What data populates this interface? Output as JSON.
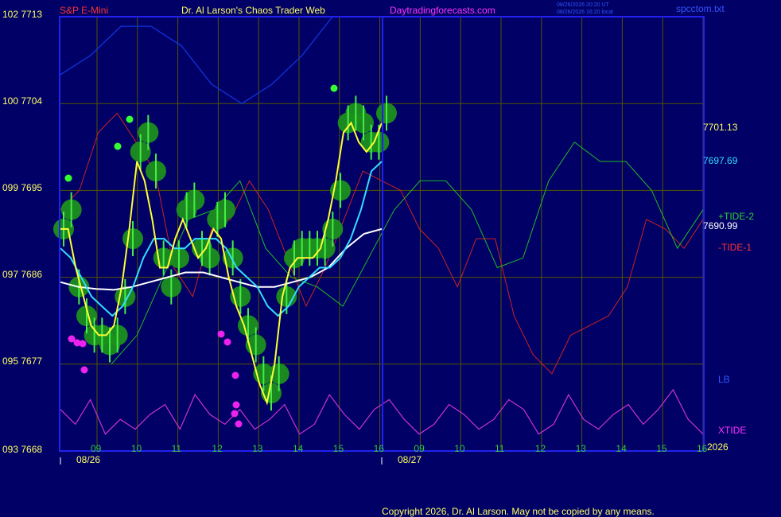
{
  "header": {
    "symbol": "S&P E-Mini",
    "title": "Dr. Al Larson's Chaos Trader Web",
    "site": "Daytradingforecasts.com",
    "time_utc": "08/26/2026 20:20 UT",
    "time_local": "08/26/2026 16:20 local",
    "file": "spcctom.txt"
  },
  "colors": {
    "background": "#000066",
    "frame": "#2222ee",
    "grid": "#555500",
    "price_bars": "#22cc22",
    "fast_ma": "#ffff33",
    "mid_ma": "#33ddff",
    "slow_ma": "#ffffff",
    "tide_minus": "#cc2222",
    "tide_plus": "#22bb22",
    "lb_line": "#1133dd",
    "xtide": "#cc33cc",
    "markers_magenta": "#ee22ee",
    "text_red": "#ff3333",
    "text_yellow": "#ffff66",
    "text_magenta": "#ff33ff",
    "text_green": "#33cc33"
  },
  "right_labels": {
    "v1": "7701.13",
    "v2": "7697.69",
    "tide_plus": "+TIDE-2",
    "v3": "7690.99",
    "tide_minus": "-TIDE-1",
    "lb": "LB",
    "xtide": "XTIDE",
    "year": "2026"
  },
  "footer": {
    "copyright": "Copyright 2026, Dr. Al Larson. May not be copied by any means."
  },
  "chart_data": {
    "type": "line",
    "y_axis": {
      "labels": [
        "102 7713",
        "100 7704",
        "099 7695",
        "097 7686",
        "095 7677",
        "093 7668"
      ],
      "ylim": [
        7668,
        7713
      ]
    },
    "x_axis": {
      "hours": [
        "09",
        "10",
        "11",
        "12",
        "13",
        "14",
        "15",
        "16",
        "09",
        "10",
        "11",
        "12",
        "13",
        "14",
        "15",
        "16"
      ],
      "dates": [
        "08/26",
        "08/27"
      ]
    },
    "price": [
      7691,
      7693,
      7685,
      7682,
      7680,
      7680,
      7679,
      7680,
      7684,
      7690,
      7699,
      7701,
      7697,
      7688,
      7685,
      7688,
      7693,
      7694,
      7689,
      7688,
      7692,
      7693,
      7688,
      7684,
      7681,
      7679,
      7676,
      7674,
      7676,
      7684,
      7688,
      7689,
      7689,
      7689,
      7689,
      7691,
      7695,
      7702,
      7703,
      7702,
      7700,
      7700,
      7703
    ],
    "fast_ma": [
      7691,
      7691,
      7687,
      7684,
      7681,
      7680,
      7680,
      7681,
      7685,
      7691,
      7698,
      7696,
      7692,
      7687,
      7687,
      7690,
      7692,
      7690,
      7688,
      7689,
      7691,
      7690,
      7686,
      7683,
      7681,
      7678,
      7675,
      7673,
      7677,
      7684,
      7687,
      7688,
      7688,
      7688,
      7689,
      7692,
      7696,
      7701,
      7702,
      7700,
      7699,
      7700,
      7702
    ],
    "mid_ma": [
      7689,
      7688,
      7686,
      7684,
      7683,
      7682,
      7683,
      7685,
      7688,
      7690,
      7690,
      7689,
      7689,
      7690,
      7690,
      7690,
      7689,
      7687,
      7686,
      7685,
      7683,
      7682,
      7683,
      7685,
      7686,
      7687,
      7687,
      7688,
      7690,
      7693,
      7697,
      7698
    ],
    "slow_ma": [
      7685.5,
      7685,
      7684.8,
      7684.7,
      7685,
      7685.5,
      7686,
      7686.5,
      7686.5,
      7686,
      7685.5,
      7685,
      7685,
      7685.5,
      7686,
      7687,
      7689,
      7690.5,
      7691
    ],
    "tide_minus": [
      7693,
      7695,
      7701,
      7703,
      7700,
      7697,
      7687,
      7684,
      7691,
      7692,
      7696,
      7693,
      7688,
      7683,
      7687,
      7692,
      7697,
      7696,
      7695,
      7691,
      7689,
      7685,
      7690,
      7690,
      7682,
      7678,
      7676,
      7680,
      7681,
      7682,
      7685,
      7692,
      7691,
      7689,
      7692
    ],
    "tide_plus": [
      7677,
      7680,
      7686,
      7692,
      7693,
      7696,
      7689,
      7686,
      7685,
      7683,
      7688,
      7693,
      7696,
      7696,
      7693,
      7687,
      7688,
      7696,
      7700,
      7698,
      7698,
      7695,
      7689,
      7693
    ],
    "lb": [
      7707,
      7709,
      7712,
      7712,
      7710,
      7706,
      7704,
      7706,
      7709,
      7713
    ],
    "xtide": [
      0.6,
      0.3,
      0.8,
      0.1,
      0.4,
      0.2,
      0.5,
      0.7,
      0.2,
      0.9,
      0.5,
      0.3,
      0.6,
      0.2,
      0.4,
      0.7,
      0.1,
      0.3,
      0.9,
      0.5,
      0.2,
      0.6,
      0.8,
      0.4,
      0.1,
      0.3,
      0.7,
      0.5,
      0.2,
      0.4,
      0.8,
      0.6,
      0.1,
      0.3,
      0.9,
      0.4,
      0.2,
      0.5,
      0.7,
      0.3,
      0.6,
      1.0,
      0.4,
      0.1
    ]
  }
}
